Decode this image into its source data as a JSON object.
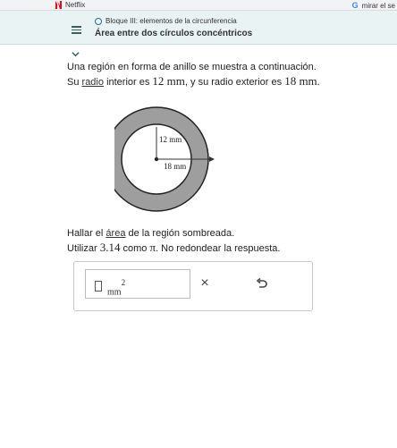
{
  "browser": {
    "bookmark_netflix": "Netflix",
    "bookmark_search": "mirar el se"
  },
  "header": {
    "topic": "Bloque III: elementos de la circunferencia",
    "title": "Área entre dos círculos concéntricos"
  },
  "problem": {
    "line1": "Una región en forma de anillo se muestra a continuación.",
    "line2_pre": "Su",
    "radius_link": "radio",
    "line2_mid": "interior es",
    "inner_value": "12 mm",
    "line2_mid2": ", y su radio exterior es",
    "outer_value": "18 mm",
    "line2_end": "."
  },
  "figure": {
    "inner_label": "12 mm",
    "outer_label": "18 mm",
    "ring_color": "#9e9e9e"
  },
  "task": {
    "line1_pre": "Hallar el",
    "area_link": "área",
    "line1_post": "de la región sombreada.",
    "line2_pre": "Utilizar",
    "pi_value": "3.14",
    "line2_mid": "como",
    "pi_symbol": "π",
    "line2_post": ". No redondear la respuesta."
  },
  "answer": {
    "unit": "mm",
    "unit_exp": "2",
    "clear_symbol": "×"
  }
}
